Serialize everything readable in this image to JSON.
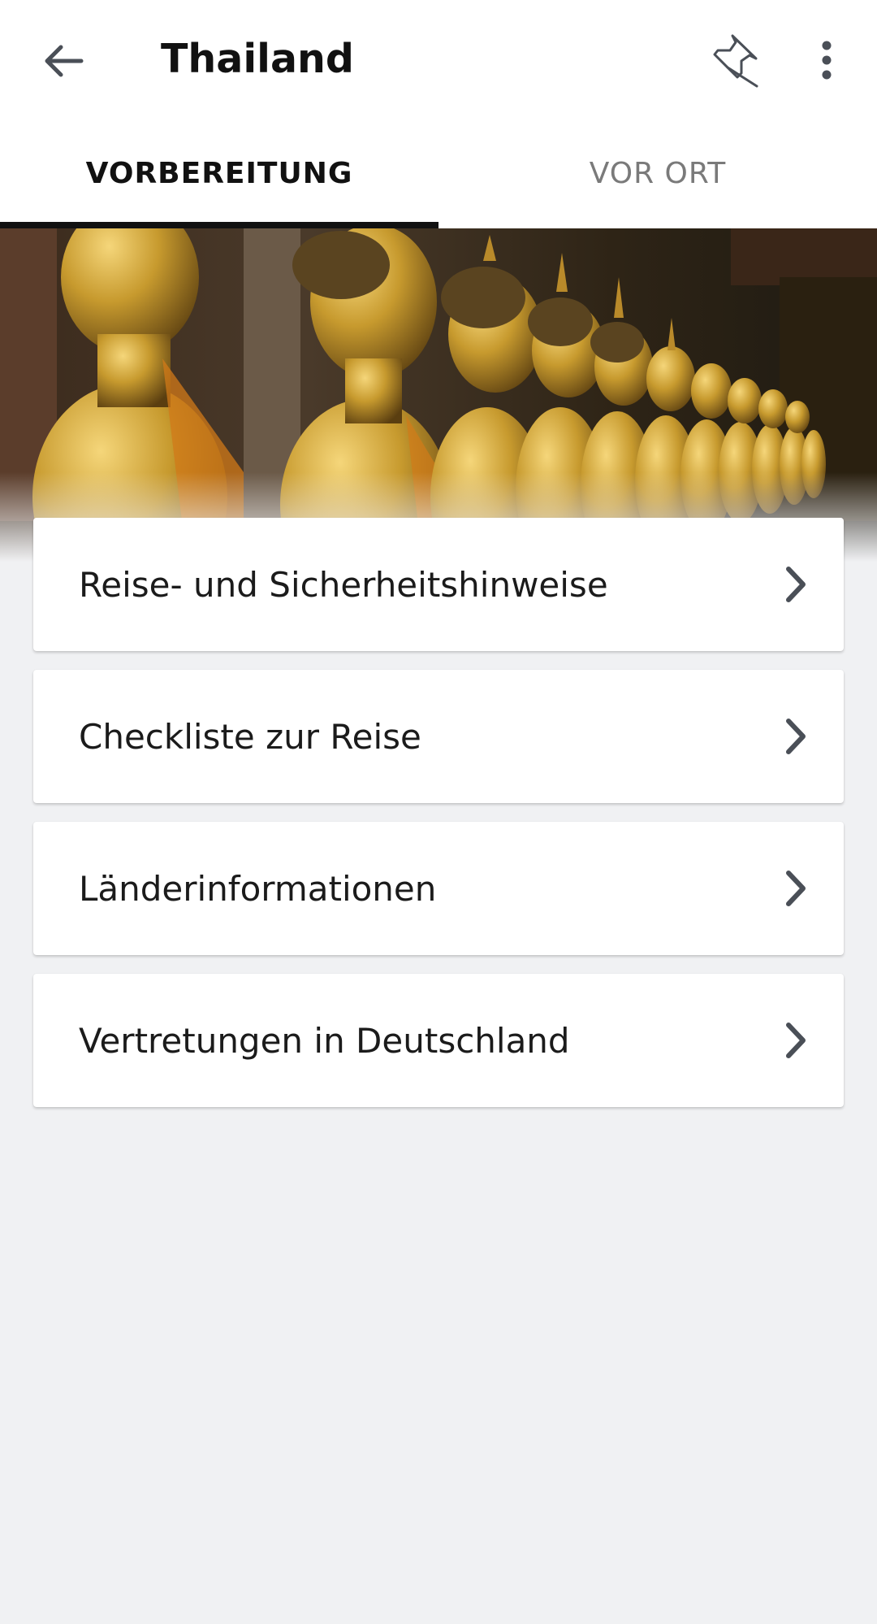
{
  "app_bar": {
    "title": "Thailand",
    "icons": {
      "back": "arrow-left-icon",
      "pin": "pin-icon",
      "more": "more-vert-icon"
    }
  },
  "tabs": [
    {
      "label": "VORBEREITUNG",
      "active": true
    },
    {
      "label": "VOR ORT",
      "active": false
    }
  ],
  "hero": {
    "image": "row-of-golden-buddha-statues"
  },
  "menu": {
    "items": [
      {
        "label": "Reise- und Sicherheitshinweise"
      },
      {
        "label": "Checkliste zur Reise"
      },
      {
        "label": "Länderinformationen"
      },
      {
        "label": "Vertretungen in Deutschland"
      }
    ]
  },
  "colors": {
    "background": "#f0f1f3",
    "surface": "#ffffff",
    "active_tab": "#111111",
    "inactive_tab": "#7a7a7a",
    "icon": "#4a4f57"
  }
}
